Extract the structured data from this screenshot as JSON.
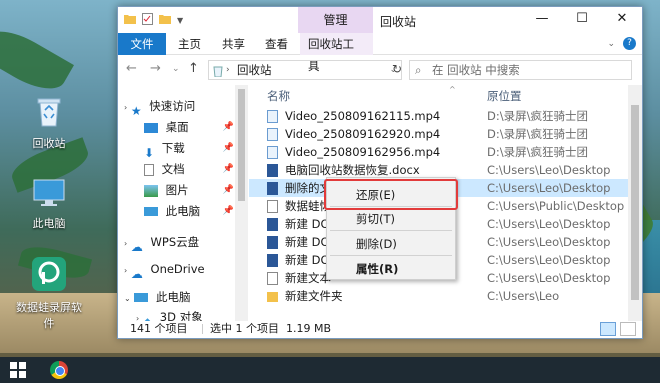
{
  "desktop": {
    "icons": [
      {
        "label": "回收站",
        "icon": "recycle-bin-icon"
      },
      {
        "label": "此电脑",
        "icon": "monitor-icon"
      },
      {
        "label": "数据蛙录屏软件",
        "icon": "app-icon"
      }
    ]
  },
  "window": {
    "title": "回收站",
    "context_tab": "管理",
    "ribbon_tabs": [
      "文件",
      "主页",
      "共享",
      "查看",
      "回收站工具"
    ],
    "address": "回收站",
    "search_placeholder": "在 回收站 中搜索"
  },
  "nav": {
    "items": [
      {
        "label": "快速访问",
        "icon": "star-icon"
      },
      {
        "label": "桌面",
        "icon": "desktop-folder-icon"
      },
      {
        "label": "下载",
        "icon": "download-icon"
      },
      {
        "label": "文档",
        "icon": "document-icon"
      },
      {
        "label": "图片",
        "icon": "picture-icon"
      },
      {
        "label": "此电脑",
        "icon": "computer-icon"
      },
      {
        "label": "WPS云盘",
        "icon": "cloud-icon"
      },
      {
        "label": "OneDrive",
        "icon": "onedrive-icon"
      },
      {
        "label": "此电脑",
        "icon": "computer-icon"
      },
      {
        "label": "3D 对象",
        "icon": "cube-icon"
      }
    ]
  },
  "columns": {
    "name": "名称",
    "location": "原位置"
  },
  "files": [
    {
      "name": "Video_250809162115.mp4",
      "location": "D:\\录屏\\疯狂骑士团"
    },
    {
      "name": "Video_250809162920.mp4",
      "location": "D:\\录屏\\疯狂骑士团"
    },
    {
      "name": "Video_250809162956.mp4",
      "location": "D:\\录屏\\疯狂骑士团"
    },
    {
      "name": "电脑回收站数据恢复.docx",
      "location": "C:\\Users\\Leo\\Desktop"
    },
    {
      "name": "删除的文",
      "location": "C:\\Users\\Leo\\Desktop"
    },
    {
      "name": "数据蛙恢",
      "location": "C:\\Users\\Public\\Desktop"
    },
    {
      "name": "新建 DOC",
      "location": "C:\\Users\\Leo\\Desktop"
    },
    {
      "name": "新建 DOC",
      "location": "C:\\Users\\Leo\\Desktop"
    },
    {
      "name": "新建 DOC",
      "location": "C:\\Users\\Leo\\Desktop"
    },
    {
      "name": "新建文本",
      "location": "C:\\Users\\Leo\\Desktop"
    },
    {
      "name": "新建文件夹",
      "location": "C:\\Users\\Leo"
    }
  ],
  "status": {
    "count": "141 个项目",
    "selected": "选中 1 个项目  1.19 MB"
  },
  "context_menu": {
    "restore": "还原(E)",
    "cut": "剪切(T)",
    "delete": "删除(D)",
    "properties": "属性(R)"
  }
}
